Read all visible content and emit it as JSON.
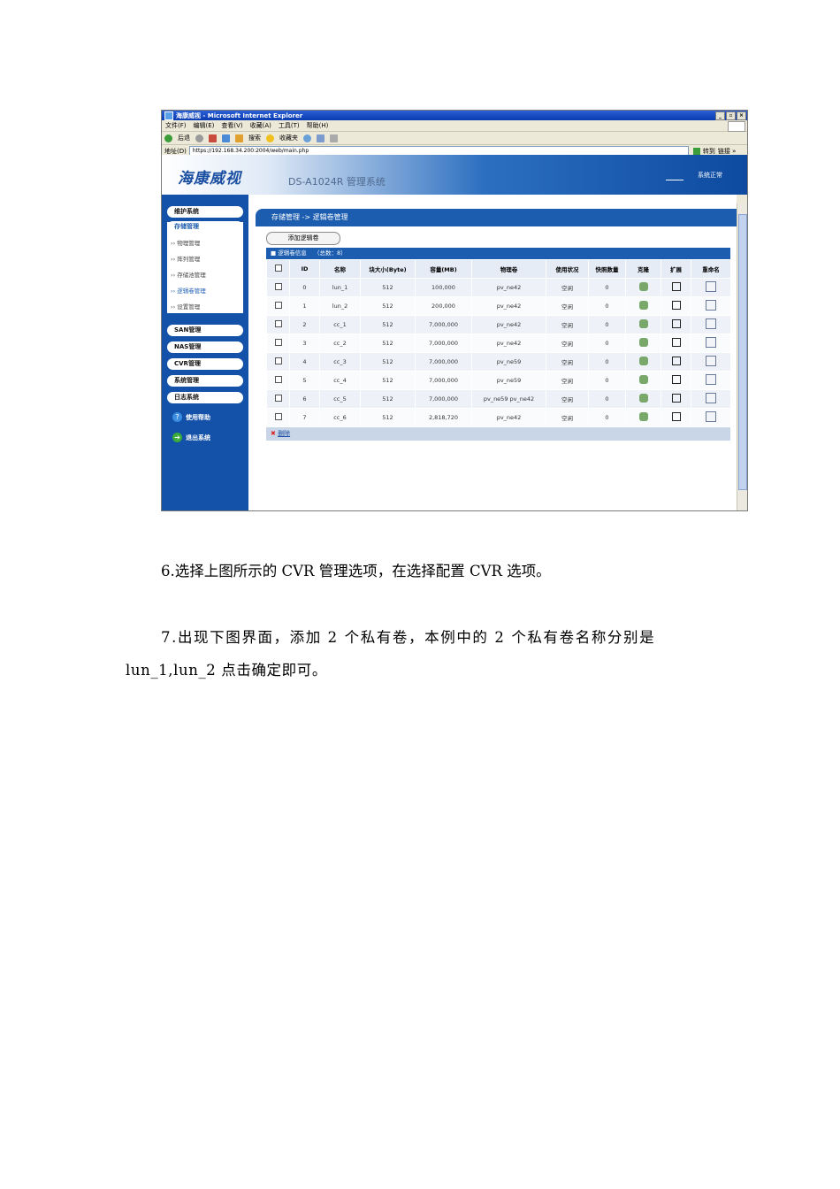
{
  "browser": {
    "title": "海康威视 - Microsoft Internet Explorer",
    "menus": [
      "文件(F)",
      "编辑(E)",
      "查看(V)",
      "收藏(A)",
      "工具(T)",
      "帮助(H)"
    ],
    "toolbar": {
      "back": "后退",
      "search": "搜索",
      "favorites": "收藏夹"
    },
    "address_label": "地址(D)",
    "address_url": "https://192.168.34.200:2004/web/main.php",
    "go": "转到",
    "links": "链接 »"
  },
  "app": {
    "logo": "海康威视",
    "system_name": "DS-A1024R 管理系统",
    "status": "系统正常"
  },
  "sidebar": {
    "items": [
      "维护系统",
      "存储管理"
    ],
    "sub_items": [
      "物理管理",
      "阵列管理",
      "存储池管理",
      "逻辑卷管理",
      "设置管理"
    ],
    "more_items": [
      "SAN管理",
      "NAS管理",
      "CVR管理",
      "系统管理",
      "日志系统"
    ],
    "help": "使用帮助",
    "logout": "退出系统"
  },
  "main": {
    "breadcrumb": "存储管理 -> 逻辑卷管理",
    "add_button": "添加逻辑卷",
    "table_title": "逻辑卷信息",
    "table_count": "（总数：8）",
    "columns": [
      "",
      "ID",
      "名称",
      "块大小(Byte)",
      "容量(MB)",
      "物理卷",
      "使用状况",
      "快照数量",
      "克隆",
      "扩展",
      "重命名"
    ],
    "rows": [
      [
        "0",
        "lun_1",
        "512",
        "100,000",
        "pv_ne42",
        "空闲",
        "0"
      ],
      [
        "1",
        "lun_2",
        "512",
        "200,000",
        "pv_ne42",
        "空闲",
        "0"
      ],
      [
        "2",
        "cc_1",
        "512",
        "7,000,000",
        "pv_ne42",
        "空闲",
        "0"
      ],
      [
        "3",
        "cc_2",
        "512",
        "7,000,000",
        "pv_ne42",
        "空闲",
        "0"
      ],
      [
        "4",
        "cc_3",
        "512",
        "7,000,000",
        "pv_ne59",
        "空闲",
        "0"
      ],
      [
        "5",
        "cc_4",
        "512",
        "7,000,000",
        "pv_ne59",
        "空闲",
        "0"
      ],
      [
        "6",
        "cc_5",
        "512",
        "7,000,000",
        "pv_ne59 pv_ne42",
        "空闲",
        "0"
      ],
      [
        "7",
        "cc_6",
        "512",
        "2,818,720",
        "pv_ne42",
        "空闲",
        "0"
      ]
    ],
    "delete_label": "删除"
  },
  "document": {
    "para6": "6.选择上图所示的 CVR 管理选项，在选择配置 CVR 选项。",
    "para7_line1": "7.出现下图界面，添加 2 个私有卷，本例中的 2 个私有卷名称分别是",
    "para7_line2": "lun_1,lun_2 点击确定即可。"
  },
  "colors": {
    "accent": "#1c5db0",
    "sidebar": "#1451a9",
    "titlebar": "#0a3bb0"
  }
}
